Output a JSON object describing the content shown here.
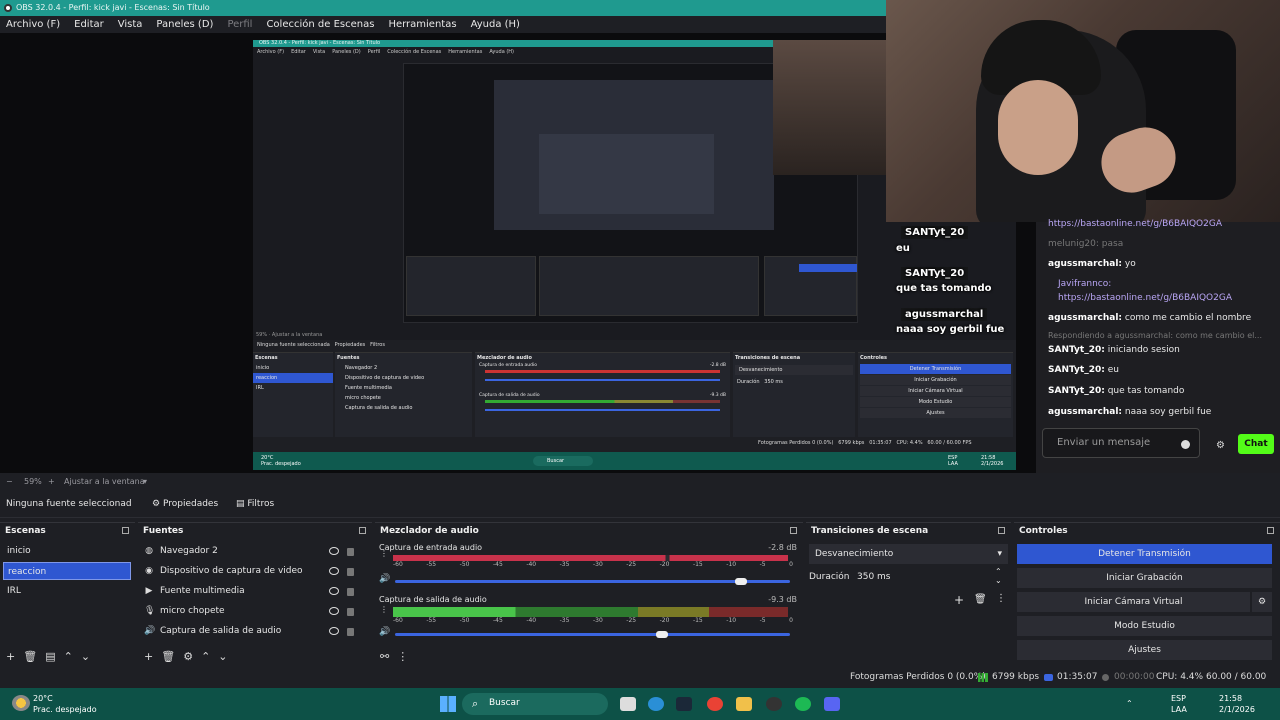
{
  "window": {
    "title": "OBS 32.0.4 - Perfil: kick javi - Escenas: Sin Título"
  },
  "menu": [
    "Archivo (F)",
    "Editar",
    "Vista",
    "Paneles (D)",
    "Perfil",
    "Colección de Escenas",
    "Herramientas",
    "Ayuda (H)"
  ],
  "preview": {
    "title": "OBS 32.0.4 - Perfil: kick javi - Escenas: Sin Título",
    "menu": [
      "Archivo (F)",
      "Editar",
      "Vista",
      "Paneles (D)",
      "Perfil",
      "Colección de Escenas",
      "Herramientas",
      "Ayuda (H)"
    ],
    "zoom": "59%",
    "fit": "Ajustar a la ventana",
    "source_none": "Ninguna fuente seleccionada",
    "props": "Propiedades",
    "filters": "Filtros",
    "scenes_title": "Escenas",
    "scenes": [
      "inicio",
      "reaccion",
      "IRL"
    ],
    "sources_title": "Fuentes",
    "sources": [
      "Navegador 2",
      "Dispositivo de captura de video",
      "Fuente multimedia",
      "micro chopete",
      "Captura de salida de audio"
    ],
    "mixer_title": "Mezclador de audio",
    "mixer_in": "Captura de entrada audio",
    "mixer_in_db": "-2.8 dB",
    "mixer_out": "Captura de salida de audio",
    "mixer_out_db": "-9.3 dB",
    "trans_title": "Transiciones de escena",
    "trans_select": "Desvanecimiento",
    "trans_dur_label": "Duración",
    "trans_dur": "350 ms",
    "controls_title": "Controles",
    "controls": [
      "Detener Transmisión",
      "Iniciar Grabación",
      "Iniciar Cámara Virtual",
      "Modo Estudio",
      "Ajustes"
    ],
    "status": "Fotogramas Perdidos 0 (0.0%)",
    "kbps": "6799 kbps",
    "time": "01:35:07",
    "cpu": "CPU: 4.4%",
    "fps": "60.00 / 60.00 FPS",
    "taskbar_search": "Buscar",
    "temp": "20°C",
    "weather": "Prac. despejado",
    "lang1": "ESP",
    "lang2": "LAA",
    "clock": "21:58",
    "date": "2/1/2026"
  },
  "overlay_chat": [
    {
      "user": "SANTyt_20",
      "text": "eu"
    },
    {
      "user": "SANTyt_20",
      "text": "que tas tomando"
    },
    {
      "user": "agussmarchal",
      "text": "naaa soy gerbil fue"
    }
  ],
  "chat": {
    "messages": [
      {
        "kind": "link",
        "text": "https://bastaonline.net/g/B6BAIQO2GA"
      },
      {
        "kind": "dim",
        "text": "melunig20: pasa"
      },
      {
        "kind": "msg",
        "user": "agussmarchal:",
        "text": "yo"
      },
      {
        "kind": "msg",
        "user": "Javifrannco:",
        "text": ""
      },
      {
        "kind": "link",
        "text": "https://bastaonline.net/g/B6BAIQO2GA"
      },
      {
        "kind": "msg",
        "user": "agussmarchal:",
        "text": "como me cambio el nombre"
      },
      {
        "kind": "dim",
        "text": "Respondiendo a agussmarchal: como me cambio el..."
      },
      {
        "kind": "msg",
        "user": "SANTyt_20:",
        "text": "iniciando sesion"
      },
      {
        "kind": "msg",
        "user": "SANTyt_20:",
        "text": "eu"
      },
      {
        "kind": "msg",
        "user": "SANTyt_20:",
        "text": "que tas tomando"
      },
      {
        "kind": "msg",
        "user": "agussmarchal:",
        "text": "naaa soy gerbil fue"
      }
    ],
    "input_placeholder": "Enviar un mensaje",
    "send_label": "Chat"
  },
  "zoom": {
    "level": "59%",
    "fit_label": "Ajustar a la ventana"
  },
  "source_bar": {
    "none_selected": "Ninguna fuente seleccionad",
    "properties": "Propiedades",
    "filters": "Filtros"
  },
  "scenes": {
    "title": "Escenas",
    "items": [
      "inicio",
      "reaccion",
      "IRL"
    ],
    "selected": "reaccion"
  },
  "sources": {
    "title": "Fuentes",
    "items": [
      {
        "label": "Navegador 2",
        "icon": "globe-icon"
      },
      {
        "label": "Dispositivo de captura de video",
        "icon": "camera-icon"
      },
      {
        "label": "Fuente multimedia",
        "icon": "play-icon"
      },
      {
        "label": "micro chopete",
        "icon": "mic-icon"
      },
      {
        "label": "Captura de salida de audio",
        "icon": "speaker-icon"
      }
    ]
  },
  "mixer": {
    "title": "Mezclador de audio",
    "channels": [
      {
        "name": "Captura de entrada audio",
        "db": "-2.8 dB",
        "volume": 0.86
      },
      {
        "name": "Captura de salida de audio",
        "db": "-9.3 dB",
        "volume": 0.66
      }
    ],
    "ticks": [
      "-60",
      "-55",
      "-50",
      "-45",
      "-40",
      "-35",
      "-30",
      "-25",
      "-20",
      "-15",
      "-10",
      "-5",
      "0"
    ]
  },
  "transitions": {
    "title": "Transiciones de escena",
    "selected": "Desvanecimiento",
    "duration_label": "Duración",
    "duration": "350 ms"
  },
  "controls": {
    "title": "Controles",
    "buttons": [
      "Detener Transmisión",
      "Iniciar Grabación",
      "Iniciar Cámara Virtual",
      "Modo Estudio",
      "Ajustes"
    ]
  },
  "status": {
    "dropped": "Fotogramas Perdidos 0 (0.0%)",
    "kbps": "6799 kbps",
    "stream_time": "01:35:07",
    "rec_time": "00:00:00",
    "cpu": "CPU: 4.4%",
    "fps": "60.00 / 60.00 FPS"
  },
  "taskbar": {
    "temp": "20°C",
    "weather": "Prac. despejado",
    "search": "Buscar",
    "lang1": "ESP",
    "lang2": "LAA",
    "time": "21:58",
    "date": "2/1/2026"
  },
  "colors": {
    "accent_blue": "#2f57d1",
    "title_teal": "#1f9a8f",
    "kick_green": "#53fc18",
    "taskbar": "#0d5147"
  }
}
